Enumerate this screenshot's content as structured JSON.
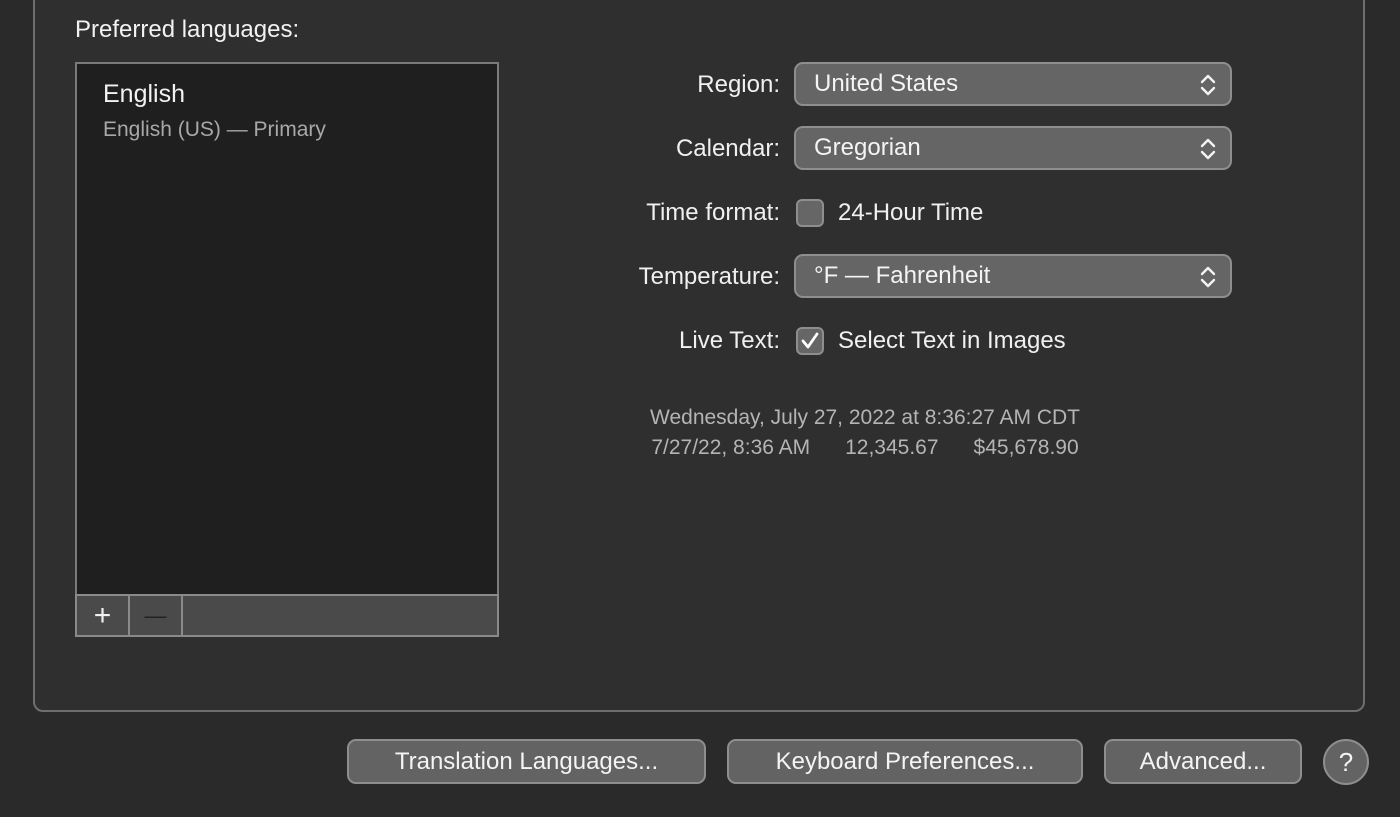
{
  "languages": {
    "label": "Preferred languages:",
    "items": [
      {
        "name": "English",
        "detail": "English (US) — Primary"
      }
    ],
    "add_icon": "plus-icon",
    "remove_icon": "minus-icon",
    "add_glyph": "+",
    "remove_glyph": "—"
  },
  "settings": {
    "region": {
      "label": "Region:",
      "value": "United States"
    },
    "calendar": {
      "label": "Calendar:",
      "value": "Gregorian"
    },
    "time_format": {
      "label": "Time format:",
      "option": "24-Hour Time",
      "checked": false
    },
    "temperature": {
      "label": "Temperature:",
      "value": "°F — Fahrenheit"
    },
    "live_text": {
      "label": "Live Text:",
      "option": "Select Text in Images",
      "checked": true
    }
  },
  "sample": {
    "line1": "Wednesday, July 27, 2022 at 8:36:27 AM CDT",
    "line2": "7/27/22, 8:36 AM      12,345.67      $45,678.90"
  },
  "buttons": {
    "translation": "Translation Languages...",
    "keyboard": "Keyboard Preferences...",
    "advanced": "Advanced...",
    "help": "?"
  }
}
